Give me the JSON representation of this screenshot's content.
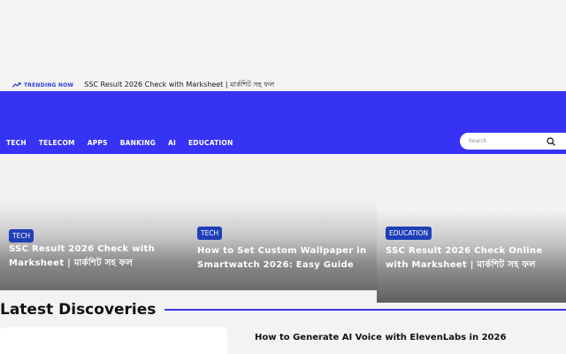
{
  "trending": {
    "label": "TRENDING NOW",
    "headline": "SSC Result 2026 Check with Marksheet | মার্কশিট সহ ফল"
  },
  "nav": {
    "items": [
      "TECH",
      "TELECOM",
      "APPS",
      "BANKING",
      "AI",
      "EDUCATION"
    ]
  },
  "search": {
    "placeholder": "Search"
  },
  "cards": [
    {
      "category": "TECH",
      "title": "SSC Result 2026 Check with Marksheet | মার্কশিট সহ ফল"
    },
    {
      "category": "TECH",
      "title": "How to Set Custom Wallpaper in Smartwatch 2026: Easy Guide"
    },
    {
      "category": "EDUCATION",
      "title": "SSC Result 2026 Check Online with Marksheet | মার্কশিট সহ ফল"
    }
  ],
  "section": {
    "title": "Latest Discoveries"
  },
  "latest": [
    {
      "title": "How to Generate AI Voice with ElevenLabs in 2026"
    }
  ],
  "colors": {
    "brand": "#3633f5",
    "badge": "#1f3fb8"
  }
}
